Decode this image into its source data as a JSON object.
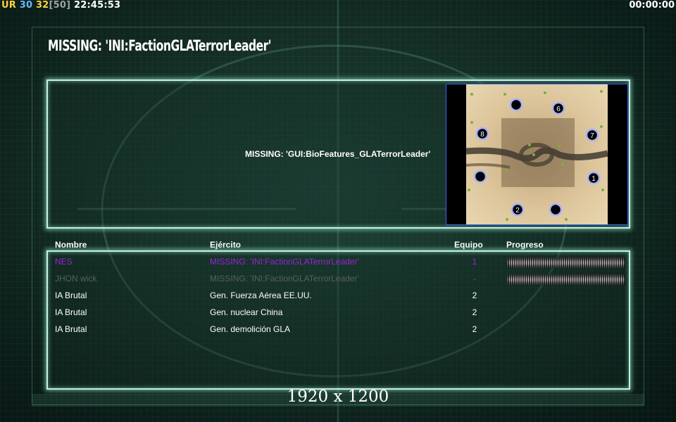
{
  "hud": {
    "ur_label": "UR",
    "fps": "30",
    "fps2": "32",
    "fps_max": "[50]",
    "clock": "22:45:53",
    "timer": "00:00:00"
  },
  "colors": {
    "ur": "#ffd23c",
    "fps": "#6ab7ff",
    "fps2": "#ffd23c",
    "fps_max": "#9aa0a6",
    "player_purple": "#9b22d8",
    "player_dim": "#56625c",
    "panel_border": "#c8f0e0",
    "map_border": "#3b62ff"
  },
  "title": "MISSING: 'INI:FactionGLATerrorLeader'",
  "bio_features": "MISSING: 'GUI:BioFeatures_GLATerrorLeader'",
  "table": {
    "headers": {
      "name": "Nombre",
      "army": "Ejército",
      "team": "Equipo",
      "progress": "Progreso"
    },
    "rows": [
      {
        "name": "NES",
        "army": "MISSING: 'INI:FactionGLATerrorLeader'",
        "team": "1",
        "progress": true,
        "style": "purple"
      },
      {
        "name": "JHON wick",
        "army": "MISSING: 'INI:FactionGLATerrorLeader'",
        "team": "-",
        "progress": true,
        "style": "dim"
      },
      {
        "name": "IA Brutal",
        "army": "Gen. Fuerza Aérea EE.UU.",
        "team": "2",
        "progress": false,
        "style": "normal"
      },
      {
        "name": "IA Brutal",
        "army": "Gen. nuclear China",
        "team": "2",
        "progress": false,
        "style": "normal"
      },
      {
        "name": "IA Brutal",
        "army": "Gen. demolición GLA",
        "team": "2",
        "progress": false,
        "style": "normal"
      }
    ]
  },
  "map": {
    "start_positions": [
      "1",
      "2",
      "6",
      "7",
      "8"
    ]
  },
  "resolution": "1920 x 1200"
}
